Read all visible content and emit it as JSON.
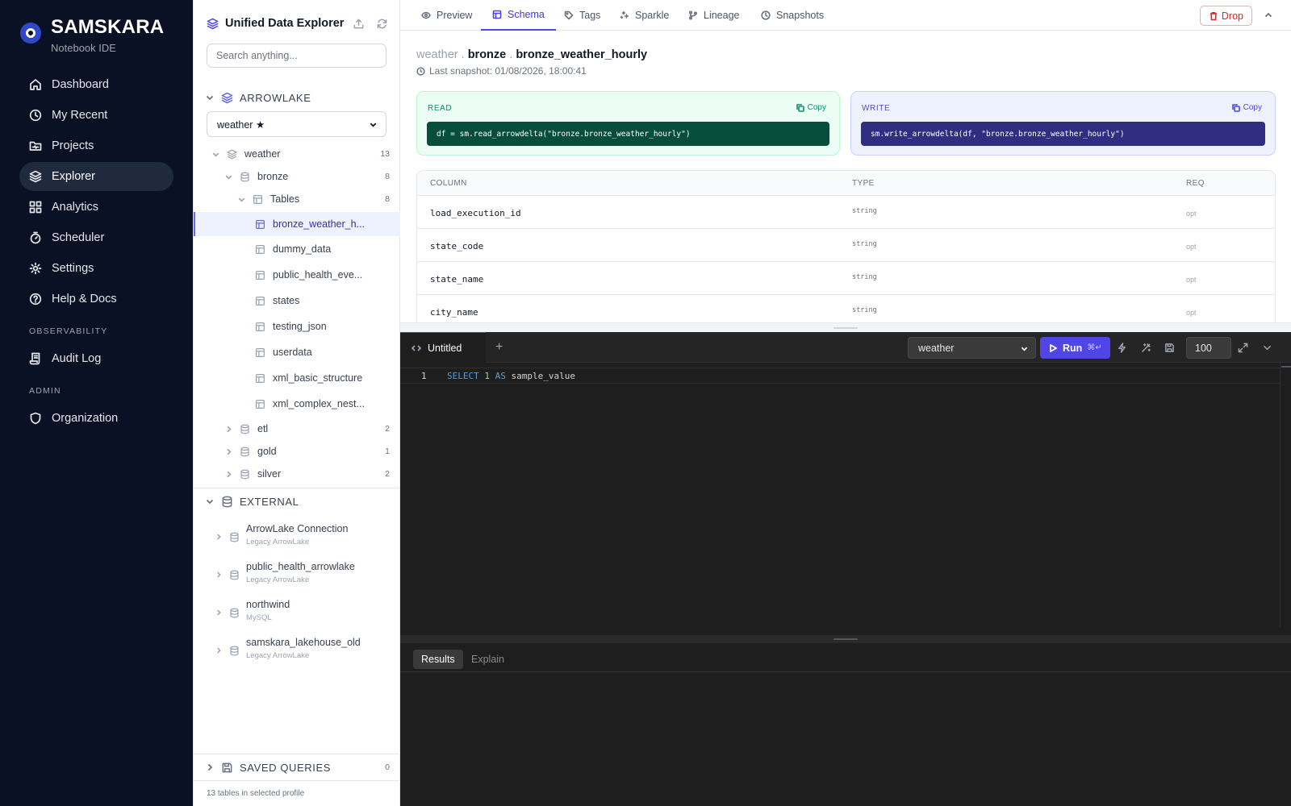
{
  "brand": {
    "name": "SAMSKARA",
    "subtitle": "Notebook IDE"
  },
  "nav": {
    "items": [
      {
        "label": "Dashboard",
        "icon": "home-icon"
      },
      {
        "label": "My Recent",
        "icon": "clock-icon"
      },
      {
        "label": "Projects",
        "icon": "folder-icon"
      },
      {
        "label": "Explorer",
        "icon": "layers-icon",
        "active": true
      },
      {
        "label": "Analytics",
        "icon": "grid-icon"
      },
      {
        "label": "Scheduler",
        "icon": "timer-icon"
      },
      {
        "label": "Settings",
        "icon": "gear-icon"
      },
      {
        "label": "Help & Docs",
        "icon": "help-icon"
      }
    ],
    "observability_label": "OBSERVABILITY",
    "observability_items": [
      {
        "label": "Audit Log",
        "icon": "scroll-icon"
      }
    ],
    "admin_label": "ADMIN",
    "admin_items": [
      {
        "label": "Organization",
        "icon": "shield-icon"
      }
    ]
  },
  "explorer": {
    "title": "Unified Data Explorer",
    "search_placeholder": "Search anything...",
    "arrowlake_label": "ARROWLAKE",
    "profile_value": "weather ★",
    "tree": {
      "weather": {
        "label": "weather",
        "count": "13"
      },
      "bronze": {
        "label": "bronze",
        "count": "8"
      },
      "tables": {
        "label": "Tables",
        "count": "8"
      },
      "table_items": [
        "bronze_weather_h...",
        "dummy_data",
        "public_health_eve...",
        "states",
        "testing_json",
        "userdata",
        "xml_basic_structure",
        "xml_complex_nest..."
      ],
      "other_schemas": [
        {
          "label": "etl",
          "count": "2"
        },
        {
          "label": "gold",
          "count": "1"
        },
        {
          "label": "silver",
          "count": "2"
        }
      ]
    },
    "external_label": "EXTERNAL",
    "external": [
      {
        "name": "ArrowLake Connection",
        "type": "Legacy ArrowLake"
      },
      {
        "name": "public_health_arrowlake",
        "type": "Legacy ArrowLake"
      },
      {
        "name": "northwind",
        "type": "MySQL"
      },
      {
        "name": "samskara_lakehouse_old",
        "type": "Legacy ArrowLake"
      }
    ],
    "saved_queries_label": "SAVED QUERIES",
    "saved_queries_count": "0",
    "footer": "13 tables in selected profile"
  },
  "tabs": {
    "items": [
      {
        "label": "Preview",
        "icon": "eye-icon"
      },
      {
        "label": "Schema",
        "icon": "table-icon",
        "active": true
      },
      {
        "label": "Tags",
        "icon": "tag-icon"
      },
      {
        "label": "Sparkle",
        "icon": "sparkle-icon"
      },
      {
        "label": "Lineage",
        "icon": "branch-icon"
      },
      {
        "label": "Snapshots",
        "icon": "clock-icon"
      }
    ],
    "drop_label": "Drop"
  },
  "detail": {
    "crumb_profile": "weather",
    "crumb_schema": "bronze",
    "crumb_table": "bronze_weather_hourly",
    "last_snapshot": "Last snapshot: 01/08/2026, 18:00:41",
    "read": {
      "label": "READ",
      "copy": "Copy",
      "code": "df = sm.read_arrowdelta(\"bronze.bronze_weather_hourly\")"
    },
    "write": {
      "label": "WRITE",
      "copy": "Copy",
      "code": "sm.write_arrowdelta(df, \"bronze.bronze_weather_hourly\")"
    },
    "schema_headers": {
      "column": "COLUMN",
      "type": "TYPE",
      "req": "REQ"
    },
    "schema_rows": [
      {
        "column": "load_execution_id",
        "type": "string",
        "req": "opt"
      },
      {
        "column": "state_code",
        "type": "string",
        "req": "opt"
      },
      {
        "column": "state_name",
        "type": "string",
        "req": "opt"
      },
      {
        "column": "city_name",
        "type": "string",
        "req": "opt"
      }
    ]
  },
  "editor": {
    "tab_label": "Untitled",
    "add_tab": "+",
    "database": "weather",
    "run_label": "Run",
    "run_shortcut": "⌘↵",
    "limit": "100",
    "line_number": "1",
    "code_tokens": {
      "kw1": "SELECT",
      "num": "1",
      "kw2": "AS",
      "ident": "sample_value"
    },
    "result_tabs": {
      "results": "Results",
      "explain": "Explain"
    }
  }
}
